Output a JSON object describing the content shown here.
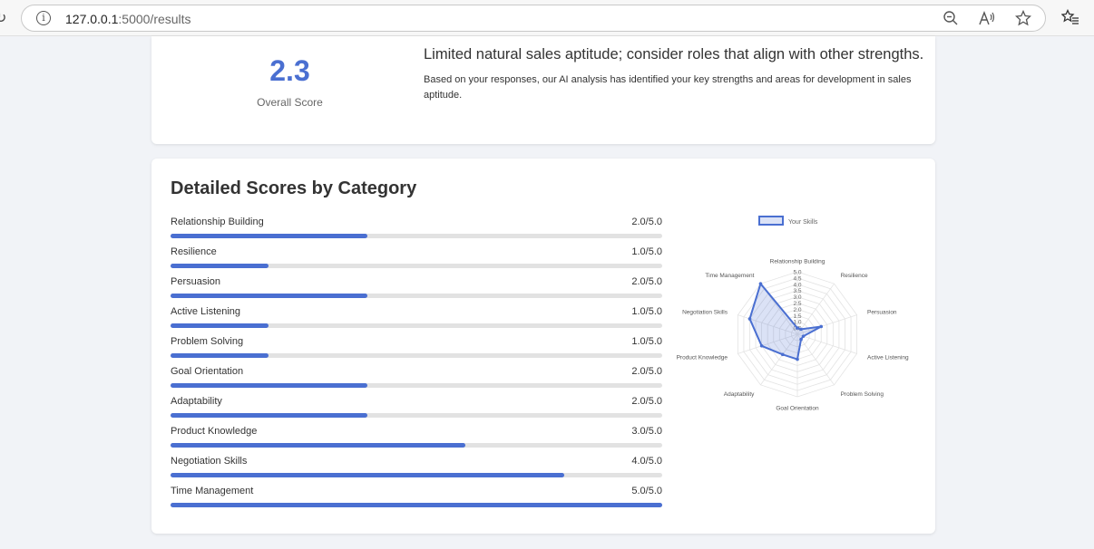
{
  "browser": {
    "url_host": "127.0.0.1",
    "url_rest": ":5000/results"
  },
  "summary": {
    "score": "2.3",
    "score_label": "Overall Score",
    "title": "Limited natural sales aptitude; consider roles that align with other strengths.",
    "text": "Based on your responses, our AI analysis has identified your key strengths and areas for development in sales aptitude."
  },
  "detail": {
    "title": "Detailed Scores by Category",
    "categories": [
      {
        "name": "Relationship Building",
        "score_text": "2.0/5.0",
        "value": 2.0
      },
      {
        "name": "Resilience",
        "score_text": "1.0/5.0",
        "value": 1.0
      },
      {
        "name": "Persuasion",
        "score_text": "2.0/5.0",
        "value": 2.0
      },
      {
        "name": "Active Listening",
        "score_text": "1.0/5.0",
        "value": 1.0
      },
      {
        "name": "Problem Solving",
        "score_text": "1.0/5.0",
        "value": 1.0
      },
      {
        "name": "Goal Orientation",
        "score_text": "2.0/5.0",
        "value": 2.0
      },
      {
        "name": "Adaptability",
        "score_text": "2.0/5.0",
        "value": 2.0
      },
      {
        "name": "Product Knowledge",
        "score_text": "3.0/5.0",
        "value": 3.0
      },
      {
        "name": "Negotiation Skills",
        "score_text": "4.0/5.0",
        "value": 4.0
      },
      {
        "name": "Time Management",
        "score_text": "5.0/5.0",
        "value": 5.0
      }
    ]
  },
  "chart_data": {
    "type": "radar",
    "categories": [
      "Relationship Building",
      "Resilience",
      "Persuasion",
      "Active Listening",
      "Problem Solving",
      "Goal Orientation",
      "Adaptability",
      "Product Knowledge",
      "Negotiation Skills",
      "Time Management"
    ],
    "series": [
      {
        "name": "Your Skills",
        "values": [
          0.5,
          0.5,
          2.0,
          0.5,
          0.5,
          2.0,
          2.0,
          3.0,
          4.0,
          5.0
        ]
      }
    ],
    "rlim": [
      0,
      5
    ],
    "ticks": [
      "0.5",
      "1.0",
      "1.5",
      "2.0",
      "2.5",
      "3.0",
      "3.5",
      "4.0",
      "4.5",
      "5.0"
    ],
    "legend_position": "top",
    "color": "#4a6fd1"
  },
  "colors": {
    "accent": "#4a6fd1",
    "track": "#e2e2e2"
  }
}
